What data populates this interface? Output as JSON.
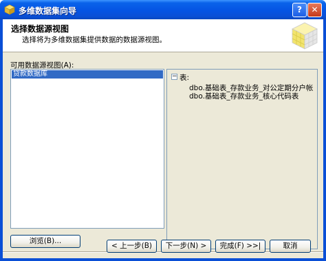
{
  "window": {
    "title": "多维数据集向导",
    "help_glyph": "?",
    "close_glyph": "✕"
  },
  "header": {
    "title": "选择数据源视图",
    "subtitle": "选择将为多维数据集提供数据的数据源视图。"
  },
  "available_views": {
    "label": "可用数据源视图(A):",
    "items": [
      "贷款数据库"
    ]
  },
  "tree": {
    "toggle": "−",
    "root": "表:",
    "children": [
      "dbo.基础表_存款业务_对公定期分户帐",
      "dbo.基础表_存款业务_核心代码表"
    ]
  },
  "buttons": {
    "browse": "浏览(B)...",
    "prev": "< 上一步(B)",
    "next": "下一步(N) >",
    "finish": "完成(F) >>|",
    "cancel": "取消"
  },
  "colors": {
    "titlebar": "#0a4fd6",
    "selection": "#316ac5",
    "panel": "#ece9d8"
  }
}
